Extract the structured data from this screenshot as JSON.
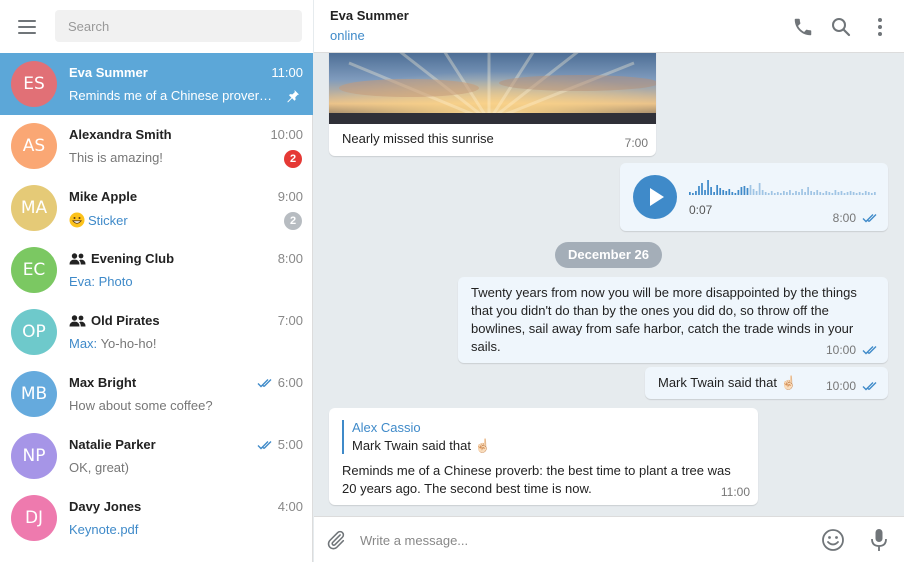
{
  "sidebar": {
    "search_placeholder": "Search",
    "menu_icon": "hamburger-menu-icon",
    "chats": [
      {
        "initials": "ES",
        "avatar_color": "#e17076",
        "name": "Eva Summer",
        "time": "11:00",
        "preview": "Reminds me of a Chinese proverb: the best time to plant a tree was 20 years ago.",
        "pinned": true,
        "active": true
      },
      {
        "initials": "AS",
        "avatar_color": "#faa774",
        "name": "Alexandra Smith",
        "time": "10:00",
        "preview": "This is amazing!",
        "unread": "2",
        "unread_color": "#e53935"
      },
      {
        "initials": "MA",
        "avatar_color": "#e5ca77",
        "name": "Mike Apple",
        "time": "9:00",
        "preview_emoji": "grinning-face-emoji",
        "preview": "Sticker",
        "unread": "2",
        "unread_color": "#b7bcc1"
      },
      {
        "initials": "EC",
        "avatar_color": "#7bc862",
        "name": "Evening Club",
        "group": true,
        "time": "8:00",
        "preview": "Eva: Photo"
      },
      {
        "initials": "OP",
        "avatar_color": "#6ec9cb",
        "name": "Old Pirates",
        "group": true,
        "time": "7:00",
        "preview_sender": "Max:",
        "preview": "Yo-ho-ho!"
      },
      {
        "initials": "MB",
        "avatar_color": "#65aadd",
        "name": "Max Bright",
        "time": "6:00",
        "read": true,
        "preview": "How about some coffee?"
      },
      {
        "initials": "NP",
        "avatar_color": "#a695e7",
        "name": "Natalie Parker",
        "time": "5:00",
        "read": true,
        "preview": "OK, great)"
      },
      {
        "initials": "DJ",
        "avatar_color": "#ee7aae",
        "name": "Davy Jones",
        "time": "4:00",
        "preview": "Keynote.pdf"
      }
    ]
  },
  "header": {
    "name": "Eva Summer",
    "status": "online",
    "icons": [
      "phone-icon",
      "search-icon",
      "more-vertical-icon"
    ]
  },
  "messages": {
    "photo": {
      "caption": "Nearly missed this sunrise",
      "time": "7:00"
    },
    "voice": {
      "duration": "0:07",
      "time": "8:00"
    },
    "date_separator": "December 26",
    "long_text": {
      "text": "Twenty years from now you will be more disappointed by the things that you didn't do than by the ones you did do, so throw off the bowlines, sail away from safe harbor, catch the trade winds in your sails.",
      "time": "10:00"
    },
    "twain": {
      "text": "Mark Twain said that ☝🏻",
      "time": "10:00"
    },
    "reply": {
      "quote_author": "Alex Cassio",
      "quote_text": "Mark Twain said that ☝🏻",
      "text": "Reminds me of a Chinese proverb: the best time to plant a tree was 20 years ago. The second best time is now.",
      "time": "11:00"
    }
  },
  "composer": {
    "placeholder": "Write a message...",
    "icons": [
      "paperclip-icon",
      "emoji-icon",
      "microphone-icon"
    ]
  },
  "colors": {
    "accent": "#3f8ac9",
    "active_row": "#5ca7d8",
    "outgoing_bubble": "#eff6fc",
    "background": "#e6ebee"
  }
}
